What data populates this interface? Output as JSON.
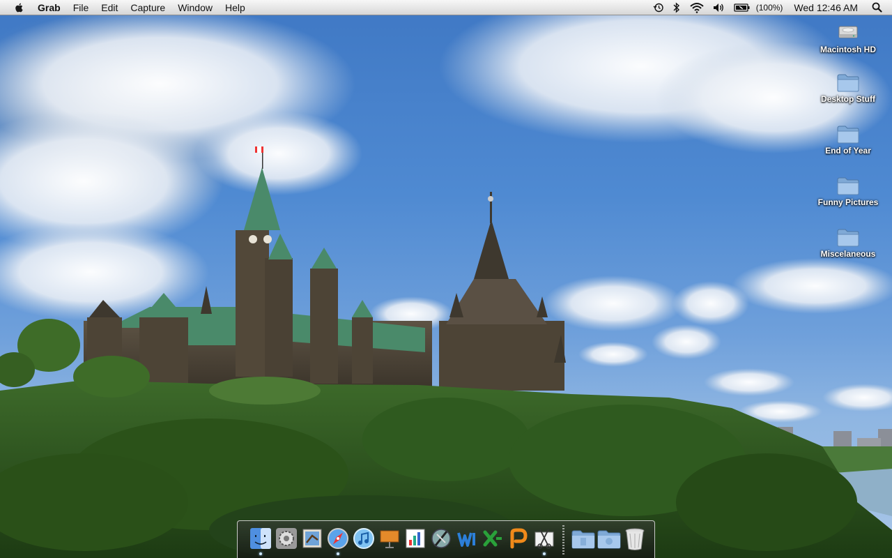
{
  "menubar": {
    "app_name": "Grab",
    "menus": [
      "File",
      "Edit",
      "Capture",
      "Window",
      "Help"
    ],
    "battery_percent": "(100%)",
    "clock": "Wed 12:46 AM",
    "icons": [
      "apple-icon",
      "time-machine-icon",
      "bluetooth-icon",
      "wifi-icon",
      "volume-icon",
      "battery-icon",
      "spotlight-icon"
    ]
  },
  "desktop_icons": [
    {
      "label": "Macintosh HD",
      "icon": "hard-drive-icon"
    },
    {
      "label": "Desktop Stuff",
      "icon": "folder-icon"
    },
    {
      "label": "End of Year",
      "icon": "folder-icon"
    },
    {
      "label": "Funny Pictures",
      "icon": "folder-icon"
    },
    {
      "label": "Miscelaneous",
      "icon": "folder-icon"
    }
  ],
  "dock": {
    "apps": [
      {
        "icon": "finder-icon",
        "running": true
      },
      {
        "icon": "system-preferences-icon",
        "running": false
      },
      {
        "icon": "mail-icon",
        "running": false
      },
      {
        "icon": "safari-icon",
        "running": true
      },
      {
        "icon": "itunes-icon",
        "running": false
      },
      {
        "icon": "keynote-icon",
        "running": false
      },
      {
        "icon": "numbers-icon",
        "running": false
      },
      {
        "icon": "script-editor-icon",
        "running": false
      },
      {
        "icon": "word-icon",
        "running": false
      },
      {
        "icon": "excel-icon",
        "running": false
      },
      {
        "icon": "powerpoint-icon",
        "running": false
      },
      {
        "icon": "grab-icon",
        "running": true
      }
    ],
    "stacks": [
      {
        "icon": "documents-folder-icon"
      },
      {
        "icon": "downloads-folder-icon"
      },
      {
        "icon": "trash-icon"
      }
    ]
  },
  "colors": {
    "sky": "#4f8ad2",
    "parliament_roof": "#4a8a6a",
    "foliage": "#2f5a1f"
  }
}
